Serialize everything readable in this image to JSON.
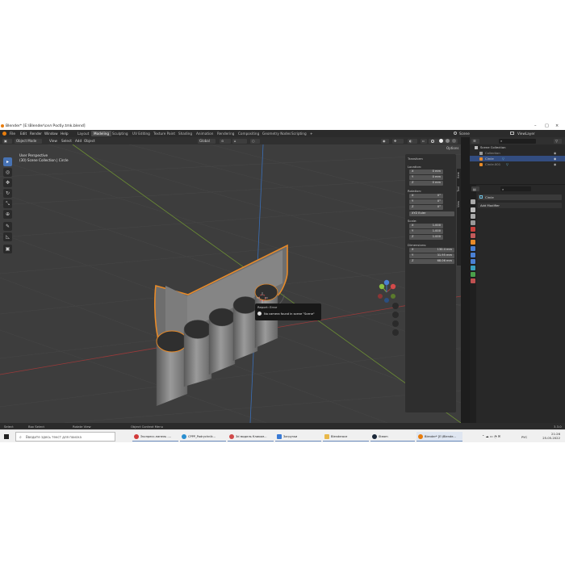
{
  "window": {
    "title": "Blender* [E:\\Blender\\сел Росбу.tmk.blend]"
  },
  "menu": [
    "File",
    "Edit",
    "Render",
    "Window",
    "Help"
  ],
  "workspaces": [
    "Layout",
    "Modeling",
    "Sculpting",
    "UV Editing",
    "Texture Paint",
    "Shading",
    "Animation",
    "Rendering",
    "Compositing",
    "Geometry Nodes",
    "Scripting"
  ],
  "active_workspace": "Modeling",
  "scene": {
    "scene_name": "Scene",
    "view_layer": "ViewLayer"
  },
  "viewport_header": {
    "mode": "Object Mode",
    "view": "View",
    "select": "Select",
    "add": "Add",
    "object": "Object",
    "orientation": "Global",
    "options": "Options"
  },
  "viewport_info": {
    "perspective": "User Perspective",
    "collection": "(30) Scene Collection | Circle"
  },
  "n_panel": {
    "section": "Transform",
    "location_label": "Location:",
    "location": [
      "0 mm",
      "0 mm",
      "0 mm"
    ],
    "rotation_label": "Rotation:",
    "rotation": [
      "0°",
      "0°",
      "0°"
    ],
    "rotation_mode": "XYZ Euler",
    "scale_label": "Scale:",
    "scale": [
      "1.000",
      "1.000",
      "1.000"
    ],
    "dimensions_label": "Dimensions:",
    "dimensions": [
      "130.4 mm",
      "31.95 mm",
      "68.06 mm"
    ],
    "axes": [
      "X",
      "Y",
      "Z"
    ],
    "tabs": [
      "Item",
      "Tool",
      "View"
    ]
  },
  "popup": {
    "title": "Report: Error",
    "message": "No camera found in scene \"Scene\""
  },
  "outliner": {
    "root": "Scene Collection",
    "items": [
      "Collection",
      "Circle",
      "Circle.001"
    ],
    "selected": "Circle"
  },
  "properties": {
    "object_name": "Circle",
    "add_modifier": "Add Modifier"
  },
  "statusbar": {
    "select": "Select",
    "box_select": "Box Select",
    "rotate_view": "Rotate View",
    "context_menu": "Object Context Menu",
    "version": "3.3.0"
  },
  "taskbar": {
    "search_placeholder": "Введите здесь текст для поиска",
    "apps": [
      "Экспресс-панель -...",
      "CPPP_Podrychnik...",
      "3d модель Кликом...",
      "Загрузки",
      "Blenderaсе",
      "Steam",
      "Blender* [E:\\Blende..."
    ],
    "language": "РУС",
    "time": "21:26",
    "date": "25.05.2022"
  },
  "colors": {
    "accent": "#4772b3",
    "selection_outline": "#e88a28",
    "viewport": "#3d3d3d",
    "x_axis": "#a83b3b",
    "y_axis": "#7aa23a",
    "z_axis": "#3a6fb8"
  }
}
